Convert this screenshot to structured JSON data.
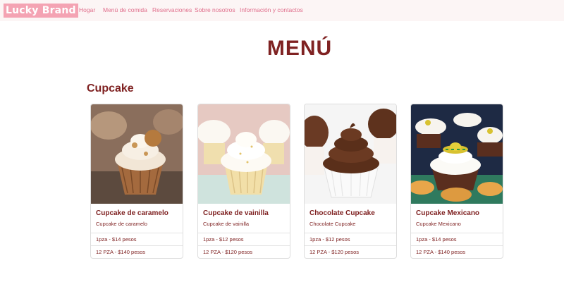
{
  "navbar": {
    "brand": "Lucky Brand",
    "links": [
      "Hogar",
      "Menú de comida",
      "Reservaciones",
      "Sobre nosotros",
      "Información y contactos"
    ]
  },
  "page": {
    "title": "MENÚ",
    "section": "Cupcake"
  },
  "cards": [
    {
      "title": "Cupcake de caramelo",
      "subtitle": "Cupcake de caramelo",
      "price1": "1pza - $14 pesos",
      "price2": "12 PZA - $140 pesos"
    },
    {
      "title": "Cupcake de vainilla",
      "subtitle": "Cupcake de vainilla",
      "price1": "1pza - $12 pesos",
      "price2": "12 PZA - $120 pesos"
    },
    {
      "title": "Chocolate Cupcake",
      "subtitle": "Chocolate Cupcake",
      "price1": "1pza - $12 pesos",
      "price2": "12 PZA - $120 pesos"
    },
    {
      "title": "Cupcake Mexicano",
      "subtitle": "Cupcake Mexicano",
      "price1": "1pza - $14 pesos",
      "price2": "12 PZA - $140 pesos"
    }
  ],
  "colors": {
    "brand_bg": "#f4a3b3",
    "nav_link": "#e06f8c",
    "heading": "#7f2222"
  }
}
